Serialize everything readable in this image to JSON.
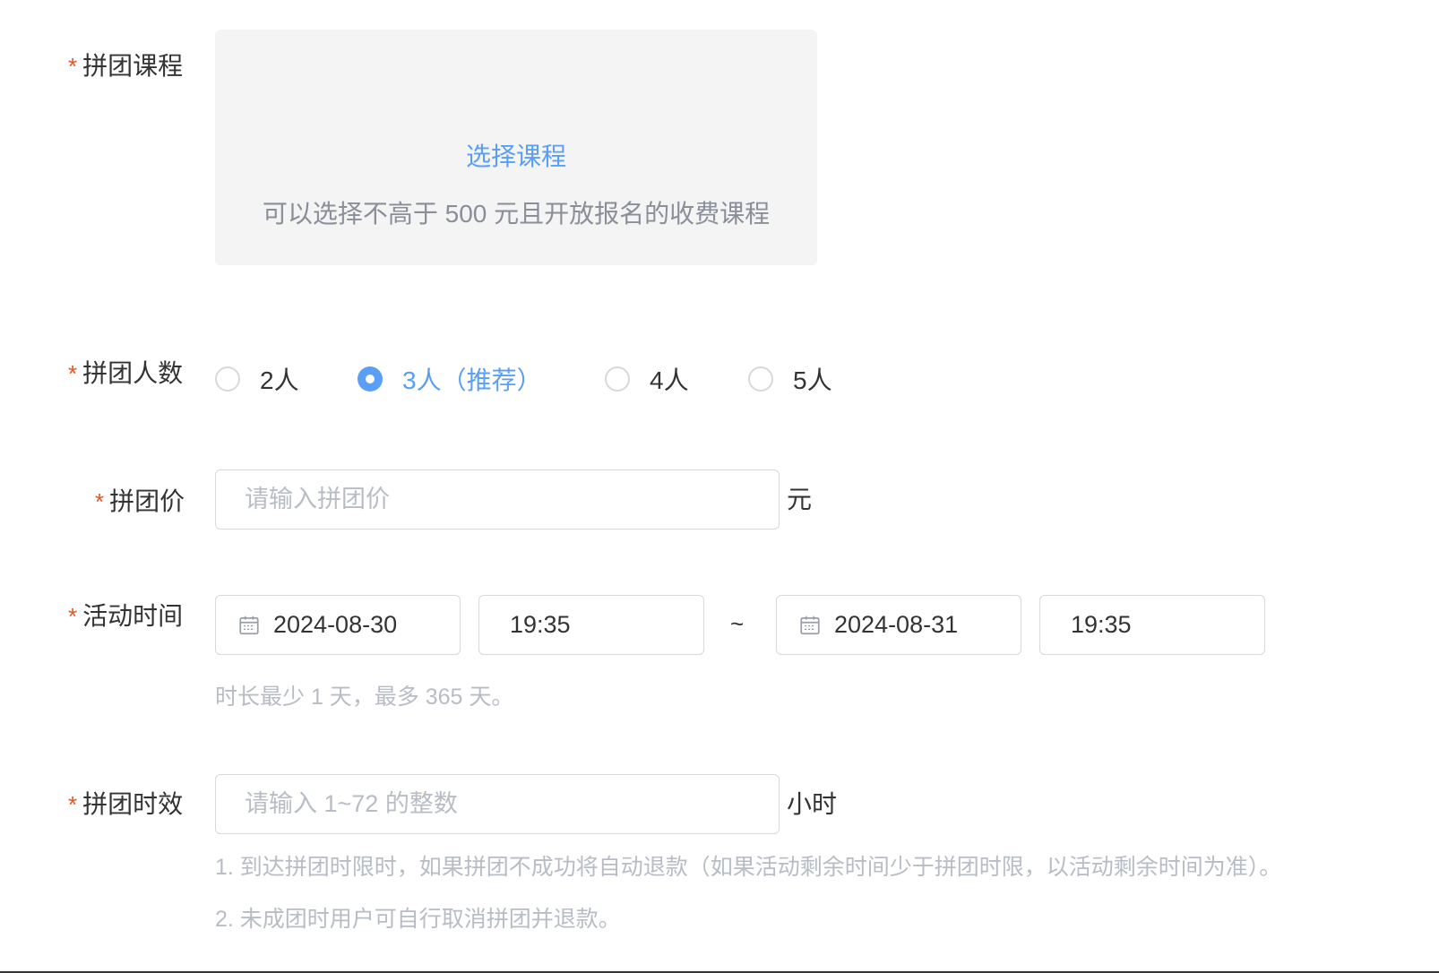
{
  "form": {
    "course": {
      "label": "拼团课程",
      "select_link": "选择课程",
      "hint": "可以选择不高于 500 元且开放报名的收费课程"
    },
    "group_size": {
      "label": "拼团人数",
      "options": [
        "2人",
        "3人（推荐）",
        "4人",
        "5人"
      ],
      "selected": "3人（推荐）"
    },
    "price": {
      "label": "拼团价",
      "placeholder": "请输入拼团价",
      "unit": "元"
    },
    "activity_time": {
      "label": "活动时间",
      "start_date": "2024-08-30",
      "start_time": "19:35",
      "separator": "~",
      "end_date": "2024-08-31",
      "end_time": "19:35",
      "hint": "时长最少 1 天，最多 365 天。"
    },
    "validity": {
      "label": "拼团时效",
      "placeholder": "请输入 1~72 的整数",
      "unit": "小时",
      "hint_1": "1. 到达拼团时限时，如果拼团不成功将自动退款（如果活动剩余时间少于拼团时限，以活动剩余时间为准）。",
      "hint_2": "2. 未成团时用户可自行取消拼团并退款。"
    },
    "required_mark": "*"
  },
  "colors": {
    "accent": "#5a9ef5",
    "required": "#e8541f",
    "hint": "#b8bcc4",
    "course_box_bg": "#f4f4f5"
  }
}
